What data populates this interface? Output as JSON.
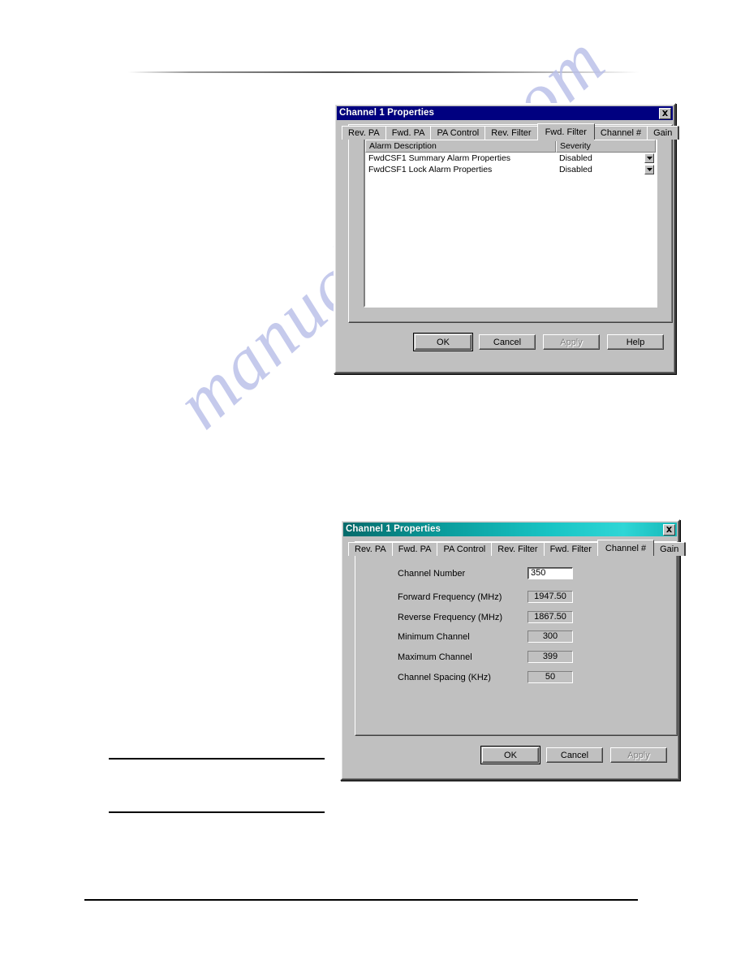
{
  "page": {
    "watermark": "manualshive.com"
  },
  "dialog_fwd_filter": {
    "title": "Channel 1 Properties",
    "close_label": "Close",
    "tabs": [
      {
        "label": "Rev. PA",
        "selected": false
      },
      {
        "label": "Fwd. PA",
        "selected": false
      },
      {
        "label": "PA Control",
        "selected": false
      },
      {
        "label": "Rev. Filter",
        "selected": false
      },
      {
        "label": "Fwd. Filter",
        "selected": true
      },
      {
        "label": "Channel #",
        "selected": false
      },
      {
        "label": "Gain",
        "selected": false
      }
    ],
    "listview": {
      "columns": [
        "Alarm Description",
        "Severity"
      ],
      "rows": [
        {
          "description": "FwdCSF1 Summary Alarm Properties",
          "severity": "Disabled"
        },
        {
          "description": "FwdCSF1 Lock Alarm Properties",
          "severity": "Disabled"
        }
      ]
    },
    "buttons": [
      {
        "label": "OK",
        "state": "default"
      },
      {
        "label": "Cancel",
        "state": "normal"
      },
      {
        "label": "Apply",
        "state": "disabled"
      },
      {
        "label": "Help",
        "state": "normal"
      }
    ]
  },
  "dialog_channel_number": {
    "title": "Channel 1 Properties",
    "close_label": "Close",
    "tabs": [
      {
        "label": "Rev. PA",
        "selected": false
      },
      {
        "label": "Fwd. PA",
        "selected": false
      },
      {
        "label": "PA Control",
        "selected": false
      },
      {
        "label": "Rev. Filter",
        "selected": false
      },
      {
        "label": "Fwd. Filter",
        "selected": false
      },
      {
        "label": "Channel #",
        "selected": true
      },
      {
        "label": "Gain",
        "selected": false
      }
    ],
    "fields": [
      {
        "label": "Channel Number",
        "value": "350",
        "editable": true
      },
      {
        "label": "Forward Frequency (MHz)",
        "value": "1947.50",
        "editable": false
      },
      {
        "label": "Reverse Frequency (MHz)",
        "value": "1867.50",
        "editable": false
      },
      {
        "label": "Minimum Channel",
        "value": "300",
        "editable": false
      },
      {
        "label": "Maximum Channel",
        "value": "399",
        "editable": false
      },
      {
        "label": "Channel Spacing (KHz)",
        "value": "50",
        "editable": false
      }
    ],
    "buttons": [
      {
        "label": "OK",
        "state": "default"
      },
      {
        "label": "Cancel",
        "state": "normal"
      },
      {
        "label": "Apply",
        "state": "disabled"
      }
    ]
  },
  "colors": {
    "titlebar_navy": "#000080",
    "titlebar_teal_dark": "#046b6b",
    "titlebar_teal_light": "#2fd6d6",
    "dialog_face": "#c0c0c0",
    "watermark": "#b9bfe8"
  }
}
